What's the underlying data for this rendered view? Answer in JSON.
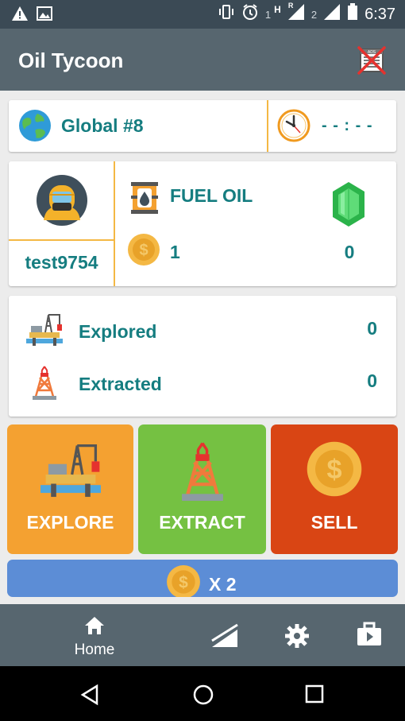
{
  "status_bar": {
    "sim1_label": "1",
    "network_label": "H",
    "roaming_label": "R",
    "sim2_label": "2",
    "time": "6:37"
  },
  "app_bar": {
    "title": "Oil Tycoon"
  },
  "rank_card": {
    "rank_text": "Global #8",
    "timer_text": "- - : - -"
  },
  "player_card": {
    "username": "test9754",
    "resource_name": "FUEL OIL",
    "coins": "1",
    "gems": "0"
  },
  "stats_card": {
    "rows": [
      {
        "label": "Explored",
        "value": "0"
      },
      {
        "label": "Extracted",
        "value": "0"
      }
    ]
  },
  "actions": {
    "explore_label": "EXPLORE",
    "extract_label": "EXTRACT",
    "sell_label": "SELL",
    "multiplier_label": "X 2"
  },
  "bottom_nav": {
    "home_label": "Home"
  },
  "colors": {
    "explore": "#f4a131",
    "extract": "#75c142",
    "sell": "#d94514",
    "multiplier": "#5c8dd6",
    "accent": "#157d80"
  }
}
